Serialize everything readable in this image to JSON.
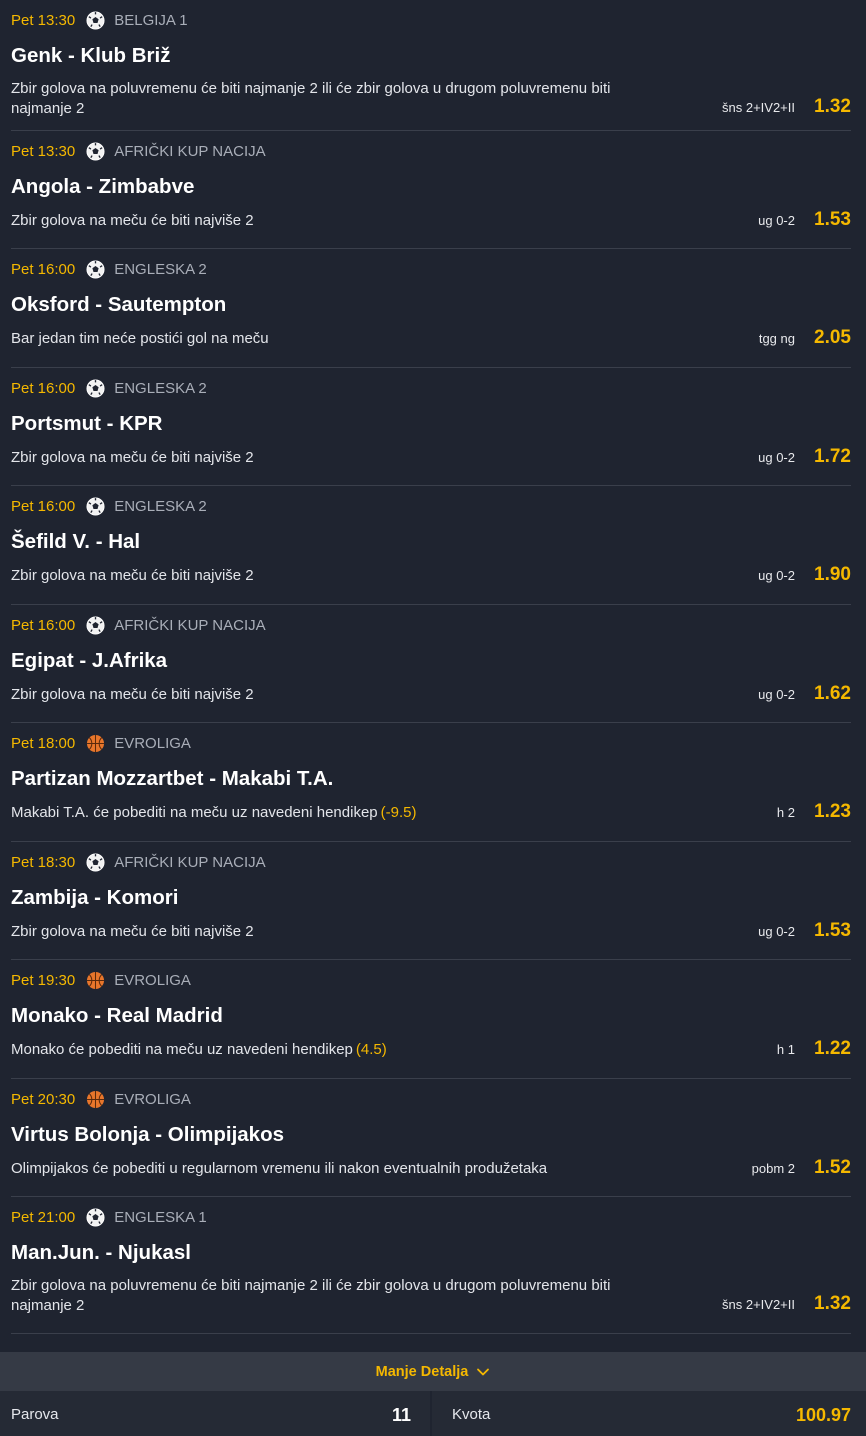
{
  "matches": [
    {
      "time": "Pet 13:30",
      "sport": "soccer-ball-icon",
      "league": "BELGIJA 1",
      "teams": "Genk - Klub Briž",
      "desc": "Zbir golova na poluvremenu će biti najmanje 2 ili će zbir golova u drugom poluvremenu biti najmanje 2",
      "handicap": "",
      "code": "šns 2+IV2+II",
      "odd": "1.32"
    },
    {
      "time": "Pet 13:30",
      "sport": "soccer-ball-icon",
      "league": "AFRIČKI KUP NACIJA",
      "teams": "Angola - Zimbabve",
      "desc": "Zbir golova na meču će biti najviše 2",
      "handicap": "",
      "code": "ug 0-2",
      "odd": "1.53"
    },
    {
      "time": "Pet 16:00",
      "sport": "soccer-ball-icon",
      "league": "ENGLESKA 2",
      "teams": "Oksford - Sautempton",
      "desc": "Bar jedan tim neće postići gol na meču",
      "handicap": "",
      "code": "tgg ng",
      "odd": "2.05"
    },
    {
      "time": "Pet 16:00",
      "sport": "soccer-ball-icon",
      "league": "ENGLESKA 2",
      "teams": "Portsmut - KPR",
      "desc": "Zbir golova na meču će biti najviše 2",
      "handicap": "",
      "code": "ug 0-2",
      "odd": "1.72"
    },
    {
      "time": "Pet 16:00",
      "sport": "soccer-ball-icon",
      "league": "ENGLESKA 2",
      "teams": "Šefild V. - Hal",
      "desc": "Zbir golova na meču će biti najviše 2",
      "handicap": "",
      "code": "ug 0-2",
      "odd": "1.90"
    },
    {
      "time": "Pet 16:00",
      "sport": "soccer-ball-icon",
      "league": "AFRIČKI KUP NACIJA",
      "teams": "Egipat - J.Afrika",
      "desc": "Zbir golova na meču će biti najviše 2",
      "handicap": "",
      "code": "ug 0-2",
      "odd": "1.62"
    },
    {
      "time": "Pet 18:00",
      "sport": "basketball-icon",
      "league": "EVROLIGA",
      "teams": "Partizan Mozzartbet - Makabi T.A.",
      "desc": "Makabi T.A. će pobediti na meču uz navedeni hendikep",
      "handicap": "(-9.5)",
      "code": "h 2",
      "odd": "1.23"
    },
    {
      "time": "Pet 18:30",
      "sport": "soccer-ball-icon",
      "league": "AFRIČKI KUP NACIJA",
      "teams": "Zambija - Komori",
      "desc": "Zbir golova na meču će biti najviše 2",
      "handicap": "",
      "code": "ug 0-2",
      "odd": "1.53"
    },
    {
      "time": "Pet 19:30",
      "sport": "basketball-icon",
      "league": "EVROLIGA",
      "teams": "Monako - Real Madrid",
      "desc": "Monako će pobediti na meču uz navedeni hendikep",
      "handicap": "(4.5)",
      "code": "h 1",
      "odd": "1.22"
    },
    {
      "time": "Pet 20:30",
      "sport": "basketball-icon",
      "league": "EVROLIGA",
      "teams": "Virtus Bolonja - Olimpijakos",
      "desc": "Olimpijakos će pobediti u regularnom vremenu ili nakon eventualnih produžetaka",
      "handicap": "",
      "code": "pobm 2",
      "odd": "1.52"
    },
    {
      "time": "Pet 21:00",
      "sport": "soccer-ball-icon",
      "league": "ENGLESKA 1",
      "teams": "Man.Jun. - Njukasl",
      "desc": "Zbir golova na poluvremenu će biti najmanje 2 ili će zbir golova u drugom poluvremenu biti najmanje 2",
      "handicap": "",
      "code": "šns 2+IV2+II",
      "odd": "1.32"
    }
  ],
  "less_details": {
    "label": "Manje Detalja",
    "icon": "chevron-down-icon"
  },
  "footer": {
    "pairs_label": "Parova",
    "pairs_value": "11",
    "odds_label": "Kvota",
    "odds_value": "100.97"
  },
  "colors": {
    "accent": "#f5b800",
    "background": "#1f2430",
    "footer": "#252a35",
    "bar": "#353a45"
  }
}
